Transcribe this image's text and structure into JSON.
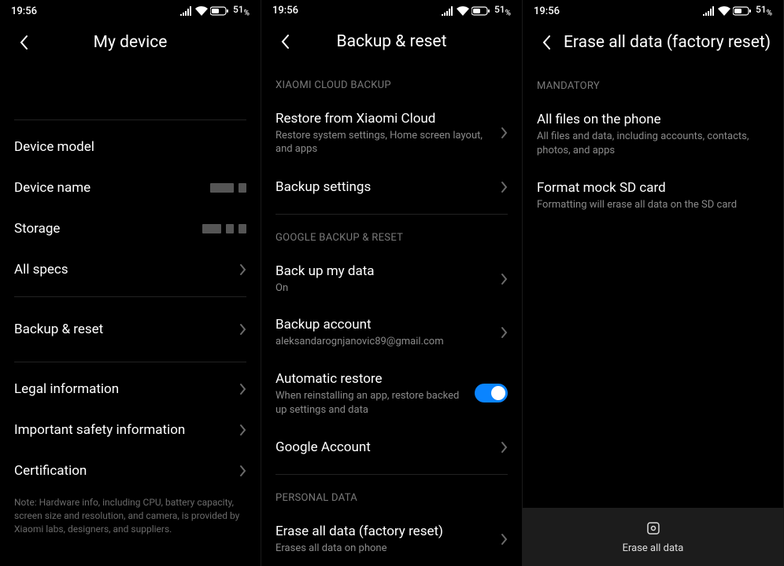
{
  "status": {
    "time": "19:56",
    "battery_pct": "51",
    "battery_suffix": "%"
  },
  "panel1": {
    "title": "My device",
    "items": {
      "device_model": "Device model",
      "device_name": "Device name",
      "storage": "Storage",
      "all_specs": "All specs",
      "backup_reset": "Backup & reset",
      "legal": "Legal information",
      "safety": "Important safety information",
      "certification": "Certification"
    },
    "note": "Note: Hardware info, including CPU, battery capacity, screen size and resolution, and camera, is provided by Xiaomi labs, designers, and suppliers."
  },
  "panel2": {
    "title": "Backup & reset",
    "sections": {
      "xiaomi": "XIAOMI CLOUD BACKUP",
      "google": "GOOGLE BACKUP & RESET",
      "personal": "PERSONAL DATA"
    },
    "restore_cloud": {
      "title": "Restore from Xiaomi Cloud",
      "sub": "Restore system settings, Home screen layout, and apps"
    },
    "backup_settings": "Backup settings",
    "back_up_data": {
      "title": "Back up my data",
      "sub": "On"
    },
    "backup_account": {
      "title": "Backup account",
      "sub": "aleksandarognjanovic89@gmail.com"
    },
    "auto_restore": {
      "title": "Automatic restore",
      "sub": "When reinstalling an app, restore backed up settings and data"
    },
    "google_account": "Google Account",
    "erase": {
      "title": "Erase all data (factory reset)",
      "sub": "Erases all data on phone"
    }
  },
  "panel3": {
    "title": "Erase all data (factory reset)",
    "section": "MANDATORY",
    "all_files": {
      "title": "All files on the phone",
      "sub": "All files and data, including accounts, contacts, photos, and apps"
    },
    "format_sd": {
      "title": "Format mock SD card",
      "sub": "Formatting will erase all data on the SD card"
    },
    "bottom_label": "Erase all data"
  }
}
